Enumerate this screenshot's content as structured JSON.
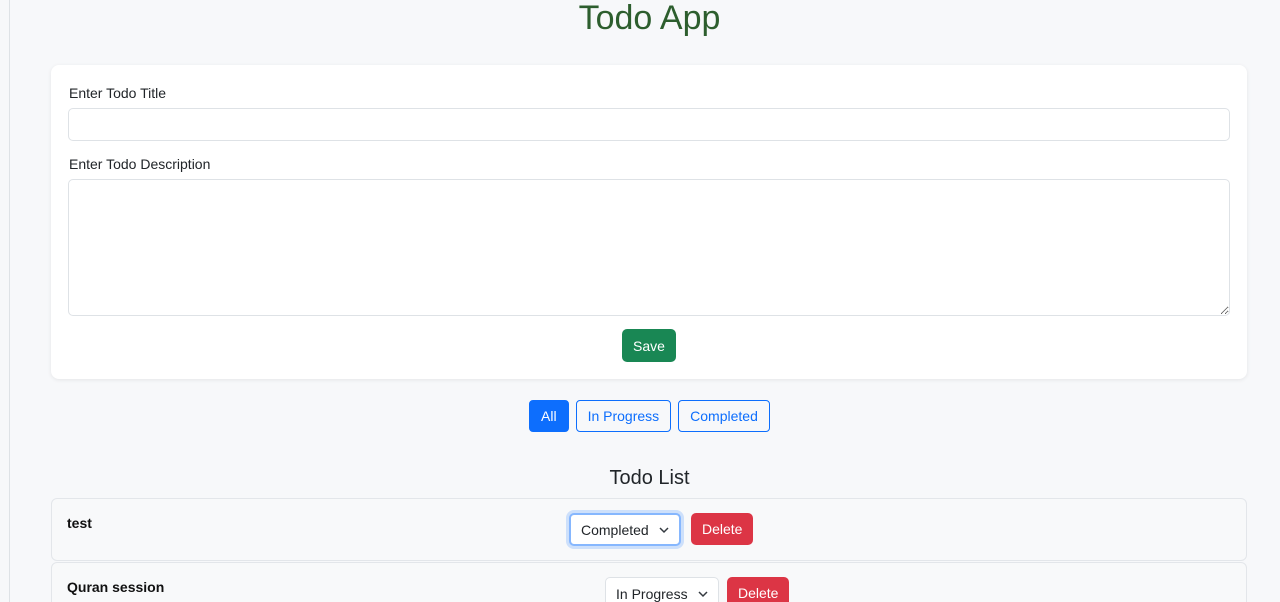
{
  "app": {
    "title": "Todo App"
  },
  "form": {
    "title_label": "Enter Todo Title",
    "title_value": "",
    "description_label": "Enter Todo Description",
    "description_value": "",
    "save_label": "Save"
  },
  "filters": [
    {
      "label": "All",
      "active": true
    },
    {
      "label": "In Progress",
      "active": false
    },
    {
      "label": "Completed",
      "active": false
    }
  ],
  "list": {
    "heading": "Todo List",
    "items": [
      {
        "title": "test",
        "status": "Completed",
        "delete_label": "Delete"
      },
      {
        "title": "Quran session",
        "status": "In Progress",
        "delete_label": "Delete"
      }
    ]
  },
  "colors": {
    "title": "#2d5e2e",
    "save": "#198754",
    "primary": "#0d6efd",
    "danger": "#dc3545"
  }
}
